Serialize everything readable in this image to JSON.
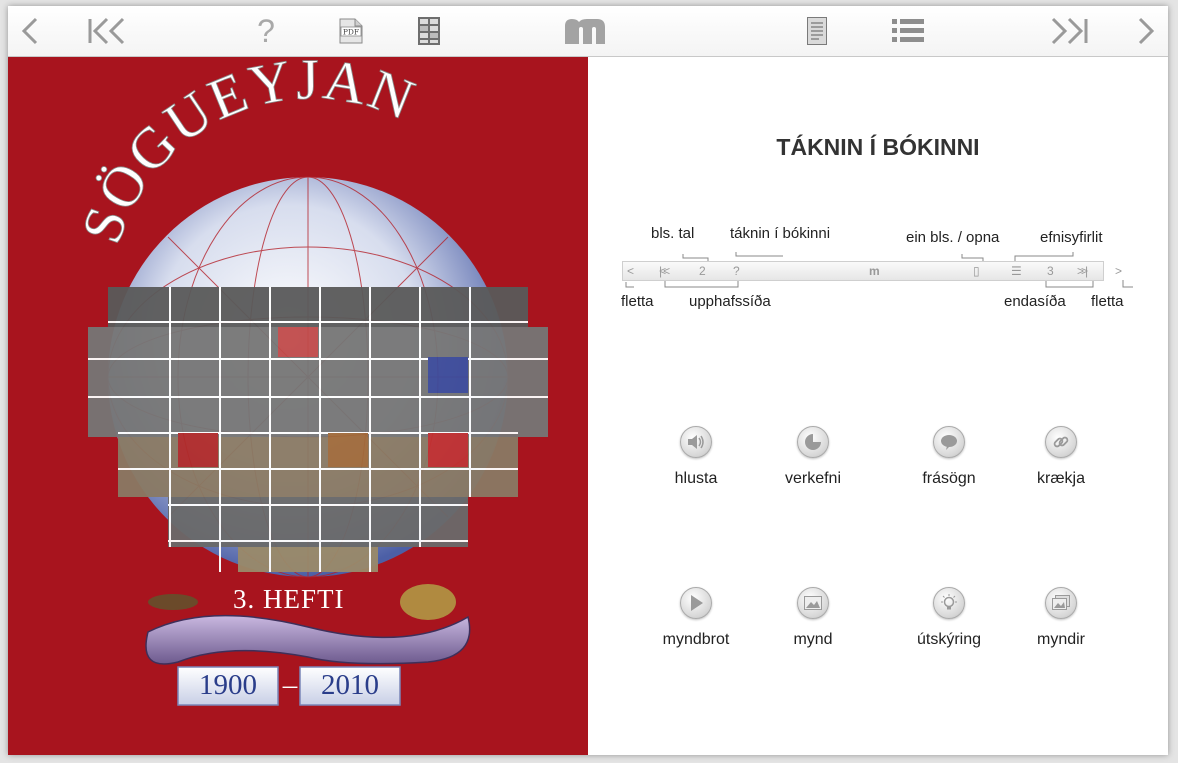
{
  "toolbar": {
    "items": [
      "prev-arrow-icon",
      "first-page-icon",
      "help-icon",
      "pdf-icon",
      "grid-icon",
      "logo-m-icon",
      "single-page-icon",
      "list-icon",
      "last-page-icon",
      "next-arrow-icon"
    ],
    "pdf_label": "PDF"
  },
  "cover": {
    "title": "SÖGUEYJAN",
    "issue": "3. HEFTI",
    "year_start": "1900",
    "year_end": "2010",
    "dash": "–",
    "background": "#a8141e"
  },
  "help": {
    "title": "TÁKNIN Í BÓKINNI",
    "labels": {
      "bls_tal": "bls. tal",
      "taknin": "táknin í bókinni",
      "ein_bls": "ein bls. / opna",
      "efnisyfirlit": "efnisyfirlit",
      "fletta_left": "fletta",
      "upphafssida": "upphafssíða",
      "endasida": "endasíða",
      "fletta_right": "fletta"
    },
    "mini_bar": {
      "page_left": "2",
      "question": "?",
      "page_right": "3"
    },
    "icons": [
      {
        "name": "speaker-icon",
        "label": "hlusta"
      },
      {
        "name": "task-icon",
        "label": "verkefni"
      },
      {
        "name": "speech-bubble-icon",
        "label": "frásögn"
      },
      {
        "name": "link-icon",
        "label": "krækja"
      },
      {
        "name": "play-icon",
        "label": "myndbrot"
      },
      {
        "name": "image-icon",
        "label": "mynd"
      },
      {
        "name": "lightbulb-icon",
        "label": "útskýring"
      },
      {
        "name": "images-icon",
        "label": "myndir"
      }
    ]
  }
}
